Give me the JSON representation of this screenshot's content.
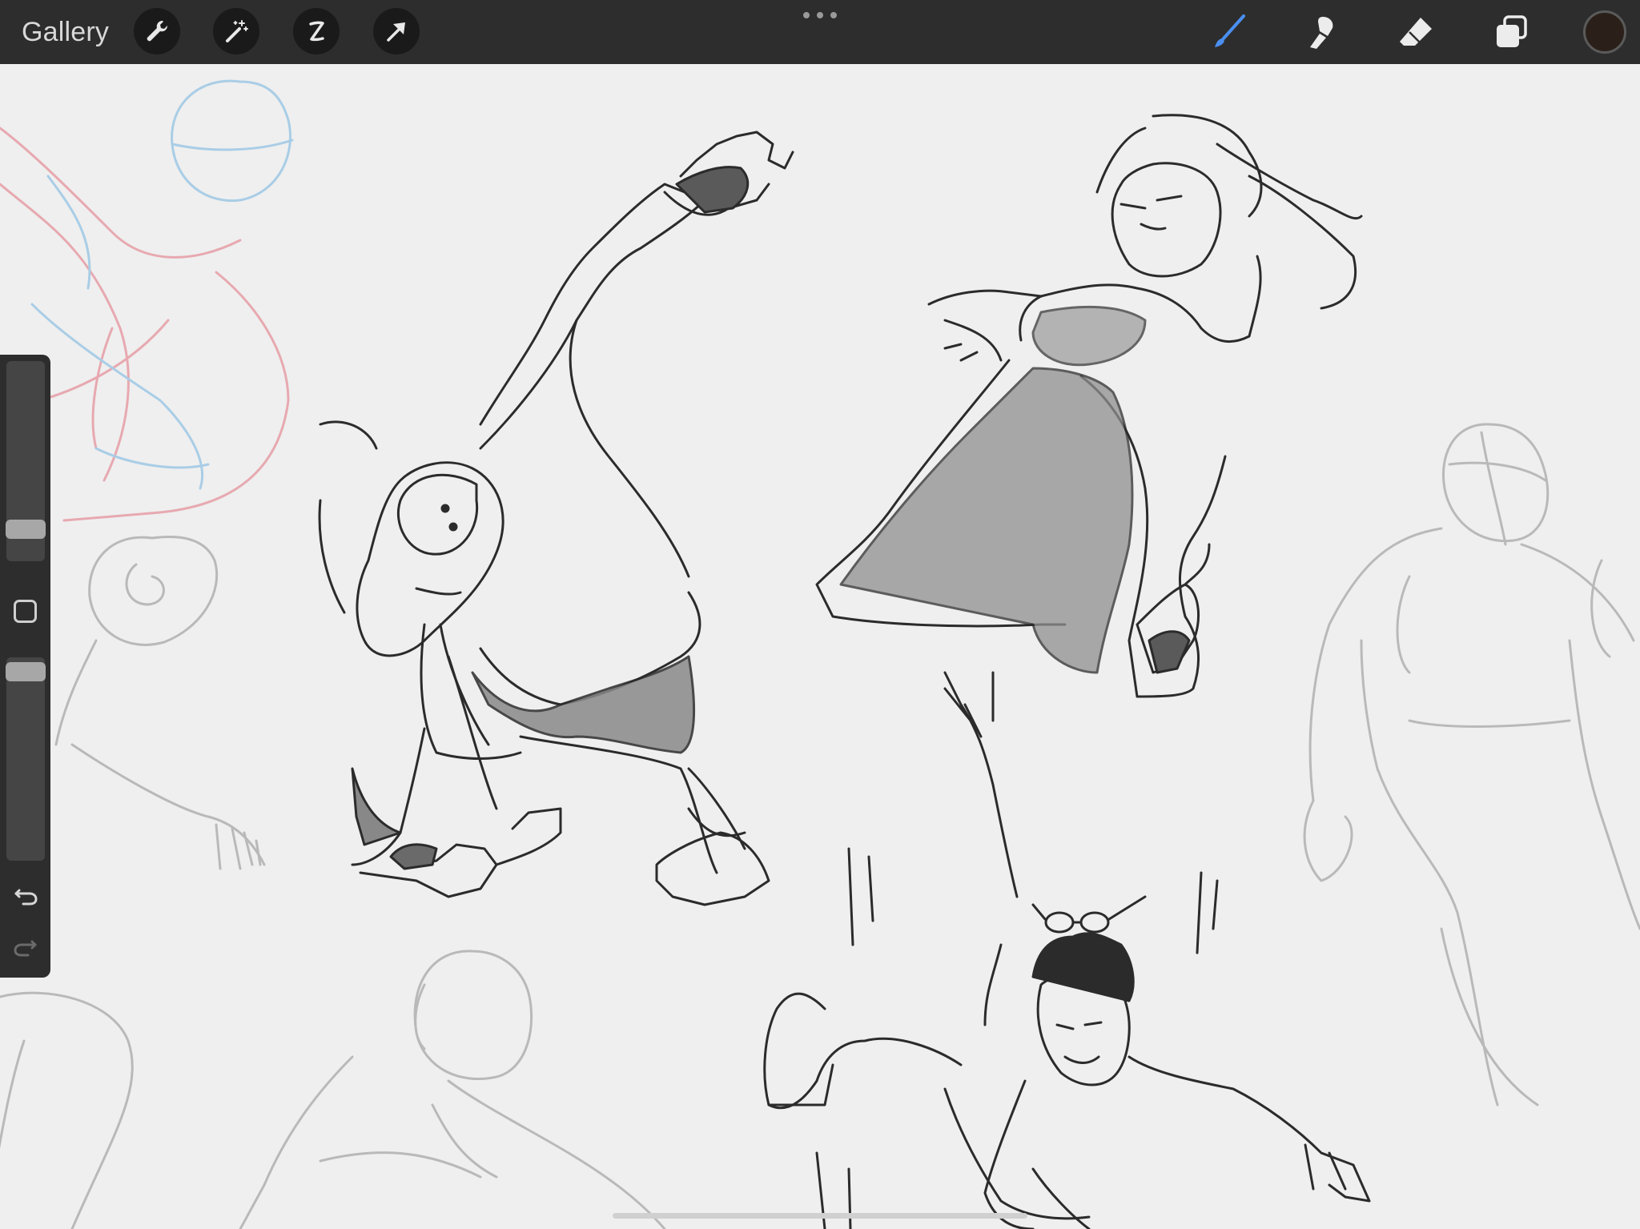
{
  "toolbar": {
    "gallery_label": "Gallery",
    "left_tools": [
      {
        "icon": "wrench-icon",
        "name": "actions"
      },
      {
        "icon": "magic-wand-icon",
        "name": "adjustments"
      },
      {
        "icon": "selection-icon",
        "name": "selection"
      },
      {
        "icon": "arrow-cursor-icon",
        "name": "transform"
      }
    ],
    "right_tools": [
      {
        "icon": "brush-icon",
        "name": "brush",
        "active": true,
        "color": "#4a8ff0"
      },
      {
        "icon": "smudge-icon",
        "name": "smudge",
        "active": false
      },
      {
        "icon": "eraser-icon",
        "name": "eraser",
        "active": false
      },
      {
        "icon": "layers-icon",
        "name": "layers",
        "active": false
      }
    ],
    "current_color": "#2a2019"
  },
  "sidebar": {
    "brush_size_level": 0.08,
    "brush_opacity_level": 0.92,
    "undo_enabled": true,
    "redo_enabled": false
  },
  "colors": {
    "toolbar_bg": "#2d2d2d",
    "canvas_bg": "#efefef",
    "ink": "#2b2b2b",
    "sketch_gray": "#b9b9b9",
    "sketch_red": "#e7a9b0",
    "sketch_blue": "#a9cde6"
  }
}
